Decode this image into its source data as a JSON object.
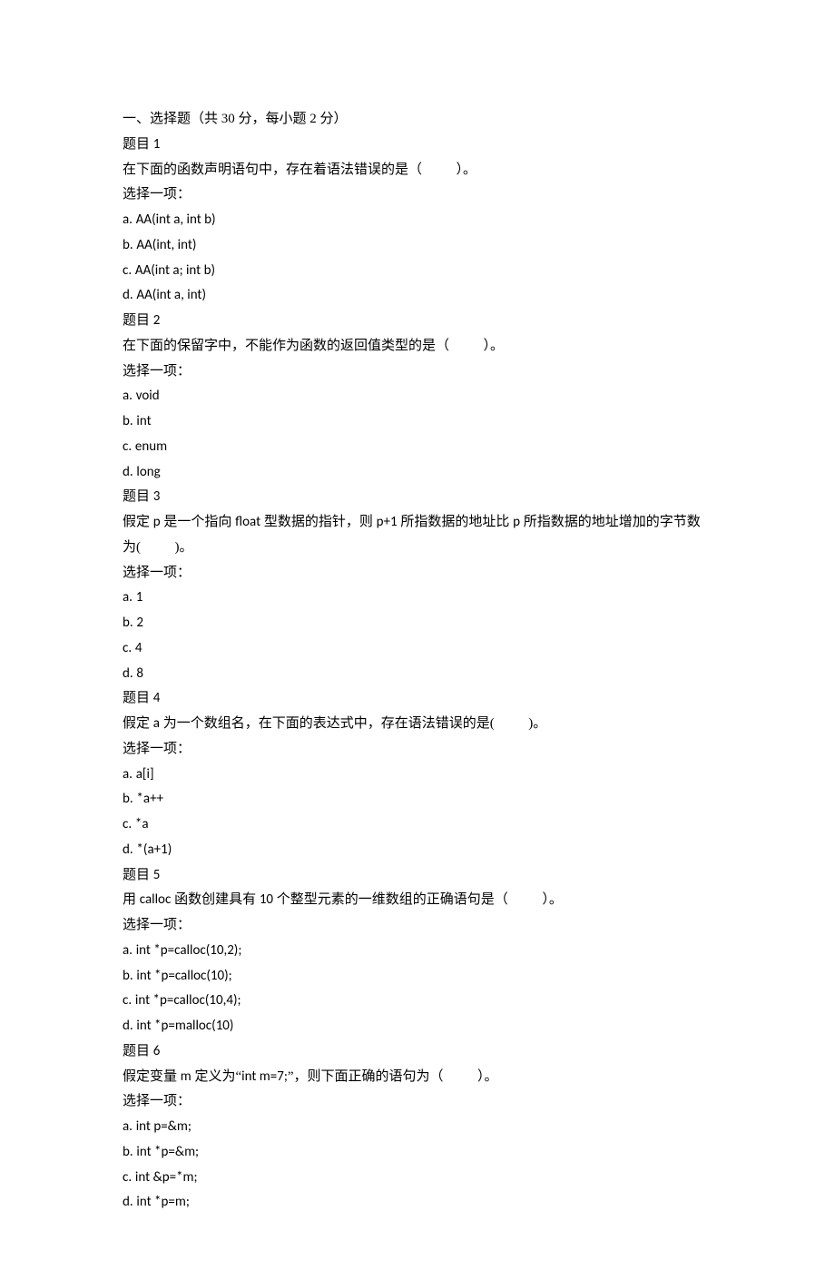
{
  "section_title": "一、选择题（共 30 分，每小题 2 分）",
  "choose_one_label": "选择一项：",
  "question_prefix": "题目",
  "questions": [
    {
      "num": "1",
      "stem_pre": "在下面的函数声明语句中，存在着语法错误的是（",
      "stem_post": "）。",
      "options": [
        {
          "label": "a.",
          "text": "AA(int a, int b)",
          "latin": true
        },
        {
          "label": "b.",
          "text": "AA(int, int)",
          "latin": true
        },
        {
          "label": "c.",
          "text": "AA(int a; int b)",
          "latin": true
        },
        {
          "label": "d.",
          "text": "AA(int a, int)",
          "latin": true
        }
      ]
    },
    {
      "num": "2",
      "stem_pre": "在下面的保留字中，不能作为函数的返回值类型的是（",
      "stem_post": "）。",
      "options": [
        {
          "label": "a.",
          "text": "void",
          "latin": true
        },
        {
          "label": "b.",
          "text": "int",
          "latin": true
        },
        {
          "label": "c.",
          "text": "enum",
          "latin": true
        },
        {
          "label": "d.",
          "text": "long",
          "latin": true
        }
      ]
    },
    {
      "num": "3",
      "stem_pre_a": "假定 ",
      "stem_mid_a": "p",
      "stem_pre_b": " 是一个指向 ",
      "stem_mid_b": "float",
      "stem_pre_c": " 型数据的指针，则 ",
      "stem_mid_c": "p+1",
      "stem_pre_d": " 所指数据的地址比 ",
      "stem_mid_d": "p",
      "stem_pre_e": " 所指数据的地址增加的字节数为(",
      "stem_post": ")。",
      "options": [
        {
          "label": "a.",
          "text": "1",
          "latin": true
        },
        {
          "label": "b.",
          "text": "2",
          "latin": true
        },
        {
          "label": "c.",
          "text": "4",
          "latin": true
        },
        {
          "label": "d.",
          "text": "8",
          "latin": true
        }
      ]
    },
    {
      "num": "4",
      "stem_pre_a": "假定 ",
      "stem_mid_a": "a",
      "stem_pre_b": " 为一个数组名，在下面的表达式中，存在语法错误的是(",
      "stem_post": ")。",
      "options": [
        {
          "label": "a.",
          "text": "a[i]",
          "latin": true
        },
        {
          "label": "b.",
          "text": "*a++",
          "latin": true
        },
        {
          "label": "c.",
          "text": "*a",
          "latin": true
        },
        {
          "label": "d.",
          "text": "*(a+1)",
          "latin": true
        }
      ]
    },
    {
      "num": "5",
      "stem_pre_a": "用 ",
      "stem_mid_a": "calloc",
      "stem_pre_b": " 函数创建具有 ",
      "stem_mid_b": "10",
      "stem_pre_c": " 个整型元素的一维数组的正确语句是（",
      "stem_post": "）。",
      "options": [
        {
          "label": "a.",
          "text": "int *p=calloc(10,2);",
          "latin": true
        },
        {
          "label": "b.",
          "text": "int *p=calloc(10);",
          "latin": true
        },
        {
          "label": "c.",
          "text": "int *p=calloc(10,4);",
          "latin": true
        },
        {
          "label": "d.",
          "text": "int *p=malloc(10)",
          "latin": true
        }
      ]
    },
    {
      "num": "6",
      "stem_pre_a": "假定变量 ",
      "stem_mid_a": "m",
      "stem_pre_b": " 定义为“",
      "stem_mid_b": "int m=7;",
      "stem_pre_c": "”，则下面正确的语句为（",
      "stem_post": "）。",
      "options": [
        {
          "label": "a.",
          "text": "int p=&m;",
          "latin": true
        },
        {
          "label": "b.",
          "text": "int *p=&m;",
          "latin": true
        },
        {
          "label": "c.",
          "text": "int &p=*m;",
          "latin": true
        },
        {
          "label": "d.",
          "text": "int *p=m;",
          "latin": true
        }
      ]
    }
  ]
}
